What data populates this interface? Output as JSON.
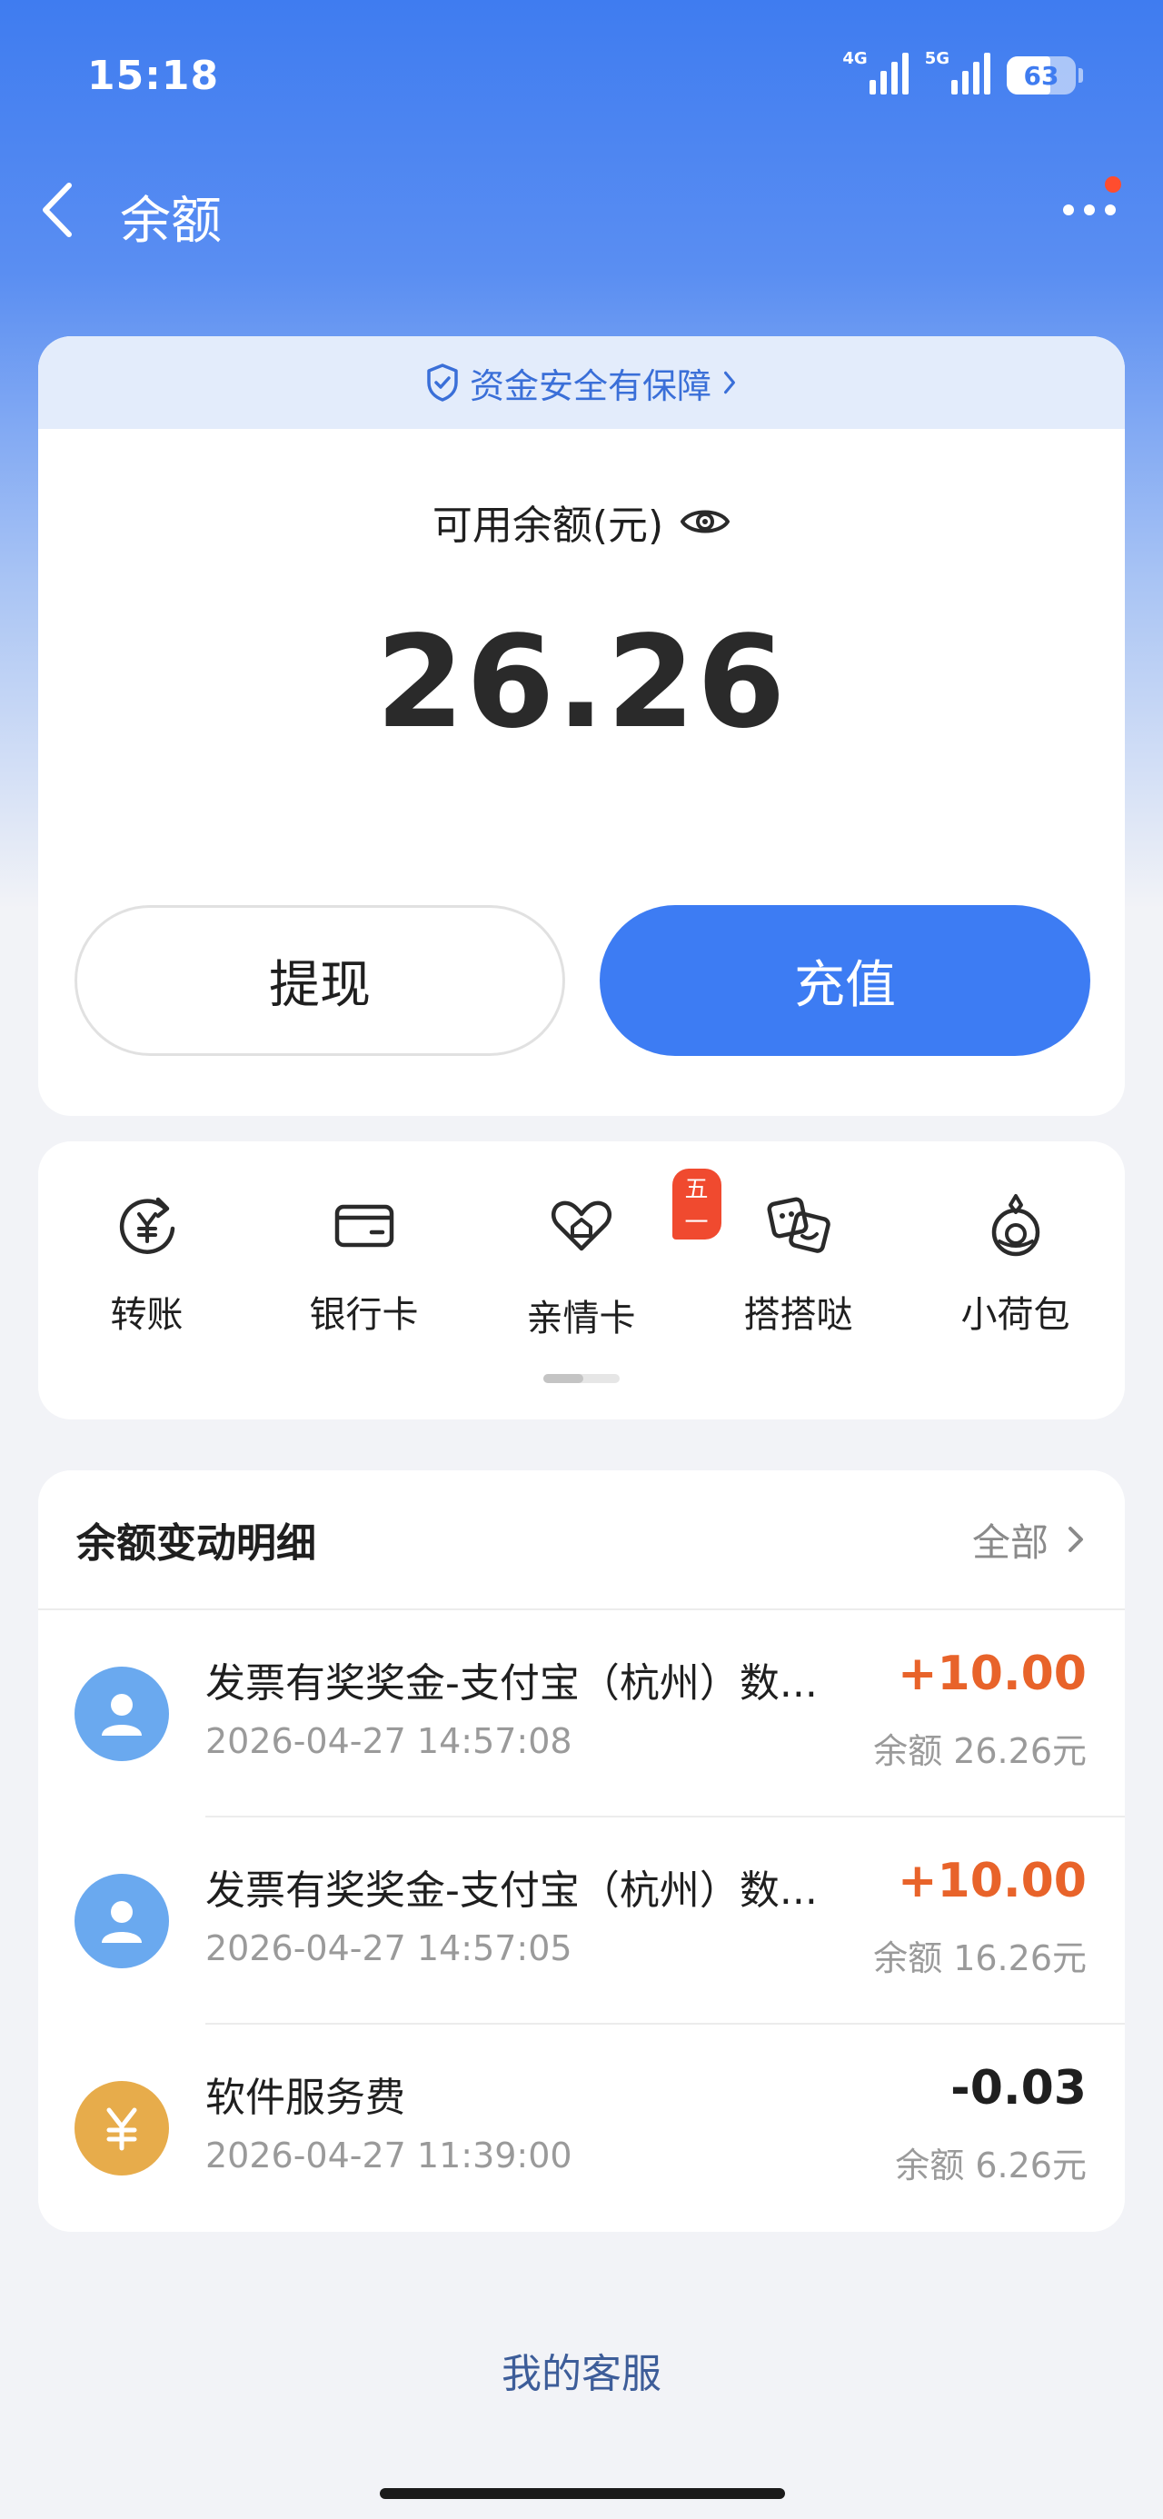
{
  "status_bar": {
    "time": "15:18",
    "net1": "4G",
    "net2": "5G",
    "battery": "63"
  },
  "nav": {
    "title": "余额"
  },
  "balance": {
    "safety_text": "资金安全有保障",
    "label": "可用余额(元)",
    "amount": "26.26",
    "withdraw_label": "提现",
    "recharge_label": "充值"
  },
  "actions": [
    {
      "label": "转账",
      "icon": "transfer-icon"
    },
    {
      "label": "银行卡",
      "icon": "bank-card-icon"
    },
    {
      "label": "亲情卡",
      "icon": "family-card-icon",
      "badge": "五一"
    },
    {
      "label": "搭搭哒",
      "icon": "dadada-icon"
    },
    {
      "label": "小荷包",
      "icon": "purse-icon"
    }
  ],
  "transactions": {
    "title": "余额变动明细",
    "filter": "全部",
    "items": [
      {
        "name": "发票有奖奖金-支付宝（杭州）数...",
        "time": "2026-04-27 14:57:08",
        "amount": "+10.00",
        "balance": "余额 26.26元"
      },
      {
        "name": "发票有奖奖金-支付宝（杭州）数...",
        "time": "2026-04-27 14:57:05",
        "amount": "+10.00",
        "balance": "余额 16.26元"
      },
      {
        "name": "软件服务费",
        "time": "2026-04-27 11:39:00",
        "amount": "-0.03",
        "balance": "余额 6.26元"
      }
    ]
  },
  "footer": {
    "service": "我的客服"
  },
  "colors": {
    "accent": "#3d7cf3",
    "positive_amount": "#e8632a",
    "badge": "#f04a2f"
  }
}
